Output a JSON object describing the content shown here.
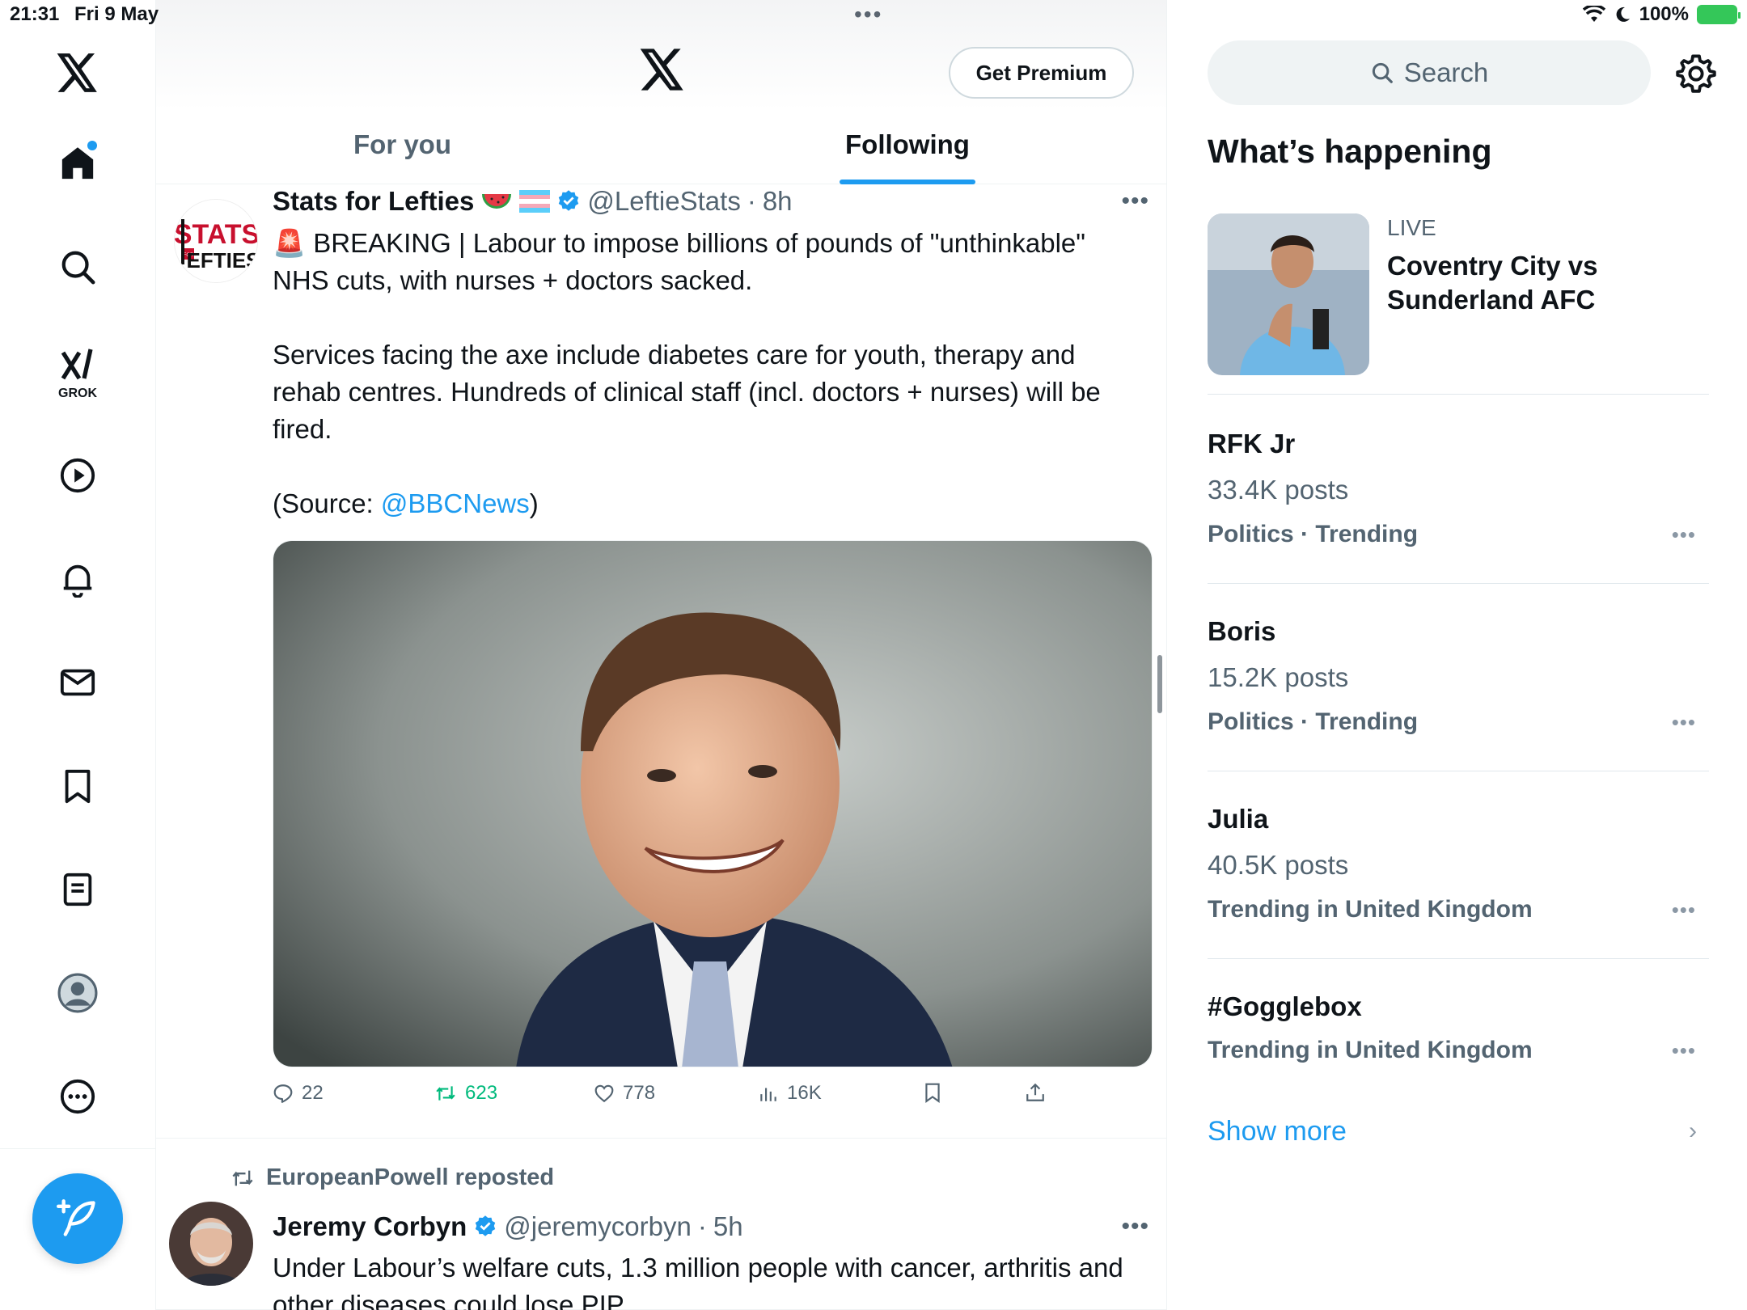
{
  "status_bar": {
    "time": "21:31",
    "date": "Fri 9 May",
    "battery": "100%"
  },
  "nav": {
    "grok_label": "GROK"
  },
  "header": {
    "premium_label": "Get Premium"
  },
  "tabs": [
    {
      "label": "For you"
    },
    {
      "label": "Following"
    }
  ],
  "tweets": [
    {
      "name": "Stats for Lefties",
      "handle": "@LeftieStats",
      "time": "8h",
      "avatar_text_top": "STATS",
      "avatar_text_bottom": "EFTIES",
      "avatar_text_small": "FOR",
      "line1": "🚨 BREAKING | Labour to impose billions of pounds of \"unthinkable\" NHS cuts, with nurses + doctors sacked.",
      "line2": "Services facing the axe include diabetes care for youth,  therapy and rehab centres. Hundreds of clinical staff (incl. doctors + nurses) will be fired.",
      "source_prefix": "(Source: ",
      "source_link": "@BBCNews",
      "source_suffix": ")",
      "replies": "22",
      "reposts": "623",
      "likes": "778",
      "views": "16K"
    },
    {
      "reposted_by": "EuropeanPowell reposted",
      "name": "Jeremy Corbyn",
      "handle": "@jeremycorbyn",
      "time": "5h",
      "text": "Under Labour’s welfare cuts, 1.3 million people with cancer, arthritis and other diseases could lose PIP."
    }
  ],
  "sidebar": {
    "search_placeholder": "Search",
    "section_title": "What’s happening",
    "live": {
      "label": "LIVE",
      "title": "Coventry City vs Sunderland AFC"
    },
    "trends": [
      {
        "title": "RFK Jr",
        "count": "33.4K posts",
        "category": "Politics · Trending"
      },
      {
        "title": "Boris",
        "count": "15.2K posts",
        "category": "Politics · Trending"
      },
      {
        "title": "Julia",
        "count": "40.5K posts",
        "category": "Trending in United Kingdom"
      },
      {
        "title": "#Gogglebox",
        "count": "",
        "category": "Trending in United Kingdom"
      }
    ],
    "show_more": "Show more"
  },
  "colors": {
    "accent": "#1d9bf0",
    "text": "#0f1419",
    "muted": "#536471",
    "repost": "#00ba7c",
    "verified": "#1d9bf0"
  },
  "icons": [
    "x-logo-icon",
    "home-icon",
    "search-icon",
    "grok-icon",
    "video-icon",
    "bell-icon",
    "mail-icon",
    "bookmark-icon",
    "list-icon",
    "profile-icon",
    "more-circle-icon",
    "compose-icon",
    "verified-icon",
    "reply-icon",
    "repost-icon",
    "like-icon",
    "views-icon",
    "share-icon",
    "settings-icon"
  ]
}
